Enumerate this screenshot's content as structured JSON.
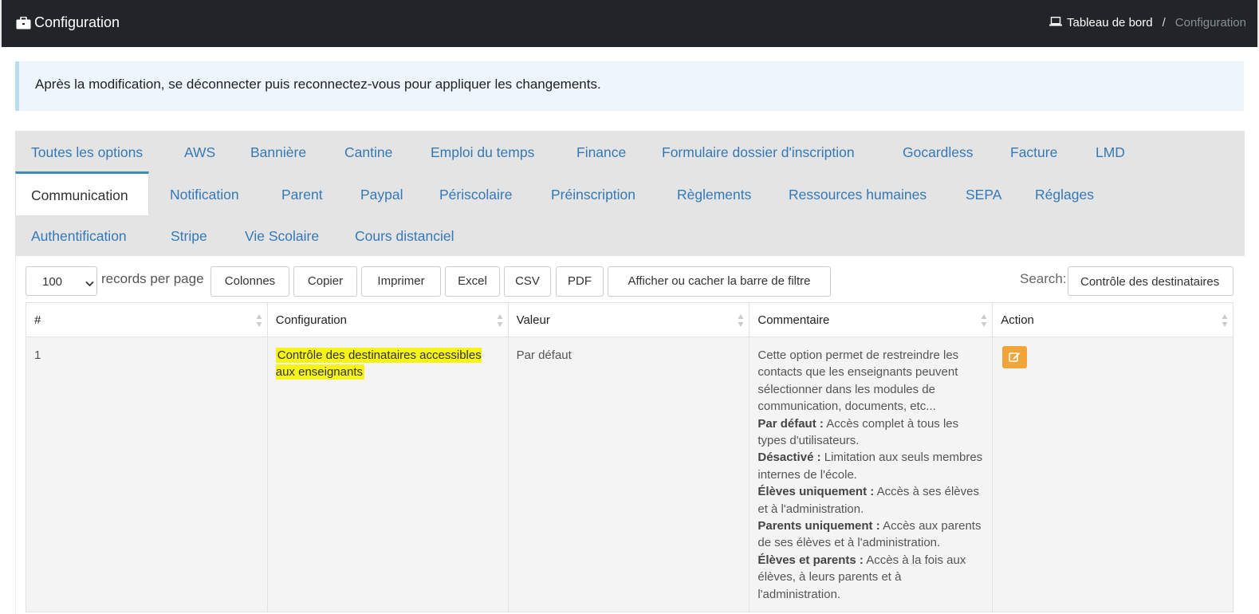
{
  "header": {
    "title": "Configuration",
    "breadcrumb": {
      "home": "Tableau de bord",
      "separator": "/",
      "current": "Configuration"
    }
  },
  "alert": "Après la modification, se déconnecter puis reconnectez-vous pour appliquer les changements.",
  "tabs": [
    "Toutes les options",
    "AWS",
    "Bannière",
    "Cantine",
    "Emploi du temps",
    "Finance",
    "Formulaire dossier d'inscription",
    "Gocardless",
    "Facture",
    "LMD",
    "Communication",
    "Notification",
    "Parent",
    "Paypal",
    "Périscolaire",
    "Préinscription",
    "Règlements",
    "Ressources humaines",
    "SEPA",
    "Réglages",
    "Authentification",
    "Stripe",
    "Vie Scolaire",
    "Cours distanciel"
  ],
  "active_tab": "Communication",
  "toolbar": {
    "page_length": "100",
    "records_per_page": "records per page",
    "buttons": [
      "Colonnes",
      "Copier",
      "Imprimer",
      "Excel",
      "CSV",
      "PDF",
      "Afficher ou cacher la barre de filtre"
    ],
    "search_label": "Search:",
    "search_value": "Contrôle des destinataires"
  },
  "table": {
    "columns": [
      "#",
      "Configuration",
      "Valeur",
      "Commentaire",
      "Action"
    ],
    "rows": [
      {
        "num": "1",
        "configuration": "Contrôle des destinataires accessibles aux enseignants",
        "valeur": "Par défaut",
        "comment_intro": "Cette option permet de restreindre les contacts que les enseignants peuvent sélectionner dans les modules de communication, documents, etc...",
        "comment_items": [
          {
            "label": "Par défaut :",
            "text": "Accès complet à tous les types d'utilisateurs."
          },
          {
            "label": "Désactivé :",
            "text": "Limitation aux seuls membres internes de l'école."
          },
          {
            "label": "Élèves uniquement :",
            "text": "Accès à ses élèves et à l'administration."
          },
          {
            "label": "Parents uniquement :",
            "text": "Accès aux parents de ses élèves et à l'administration."
          },
          {
            "label": "Élèves et parents :",
            "text": "Accès à la fois aux élèves, à leurs parents et à l'administration."
          }
        ],
        "action_icon": "edit-icon"
      }
    ]
  },
  "colors": {
    "topbar": "#212529",
    "link": "#3379b7",
    "alert_bg": "#eef6fd",
    "highlight": "#f5f317",
    "edit_button": "#f0a43a"
  }
}
